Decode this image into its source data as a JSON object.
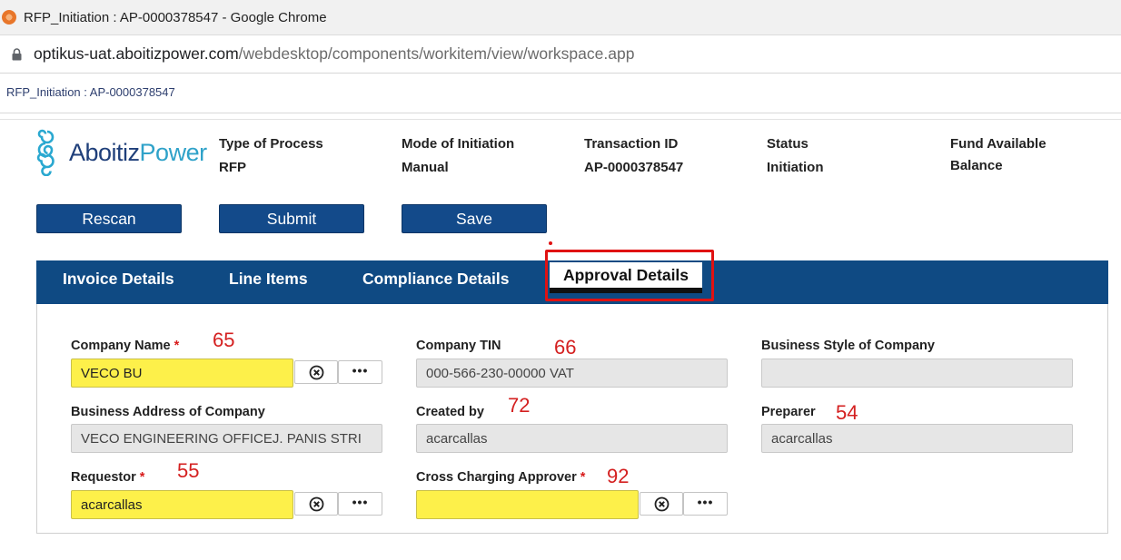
{
  "browser": {
    "window_title": "RFP_Initiation : AP-0000378547 - Google Chrome",
    "url_host": "optikus-uat.aboitizpower.com",
    "url_path": "/webdesktop/components/workitem/view/workspace.app"
  },
  "breadcrumb": "RFP_Initiation : AP-0000378547",
  "logo": {
    "part1": "Aboitiz",
    "part2": "Power"
  },
  "meta": {
    "type_of_process": {
      "label": "Type of Process",
      "value": "RFP"
    },
    "mode_of_initiation": {
      "label": "Mode of Initiation",
      "value": "Manual"
    },
    "transaction_id": {
      "label": "Transaction ID",
      "value": "AP-0000378547"
    },
    "status": {
      "label": "Status",
      "value": "Initiation"
    },
    "fund_available": {
      "label": "Fund Available",
      "label2": "Balance"
    }
  },
  "actions": {
    "rescan": "Rescan",
    "submit": "Submit",
    "save": "Save"
  },
  "tabs": {
    "invoice_details": "Invoice Details",
    "line_items": "Line Items",
    "compliance_details": "Compliance Details",
    "approval_details": "Approval Details"
  },
  "form": {
    "company_name": {
      "label": "Company Name",
      "required": "*",
      "value": "VECO BU",
      "note": "65"
    },
    "company_tin": {
      "label": "Company TIN",
      "value": "000-566-230-00000 VAT",
      "note": "66"
    },
    "business_style": {
      "label": "Business Style of Company",
      "value": ""
    },
    "business_address": {
      "label": "Business Address of Company",
      "value": "VECO ENGINEERING OFFICEJ. PANIS STRI"
    },
    "created_by": {
      "label": "Created by",
      "value": "acarcallas",
      "note": "72"
    },
    "preparer": {
      "label": "Preparer",
      "value": "acarcallas",
      "note": "54"
    },
    "requestor": {
      "label": "Requestor",
      "required": "*",
      "value": "acarcallas",
      "note": "55"
    },
    "cross_charging_approver": {
      "label": "Cross Charging Approver",
      "required": "*",
      "value": "",
      "note": "92"
    }
  },
  "colors": {
    "tab_bar": "#0f4a83",
    "button": "#134a8a",
    "required_field": "#fdf04a",
    "annotation": "#d42020"
  }
}
